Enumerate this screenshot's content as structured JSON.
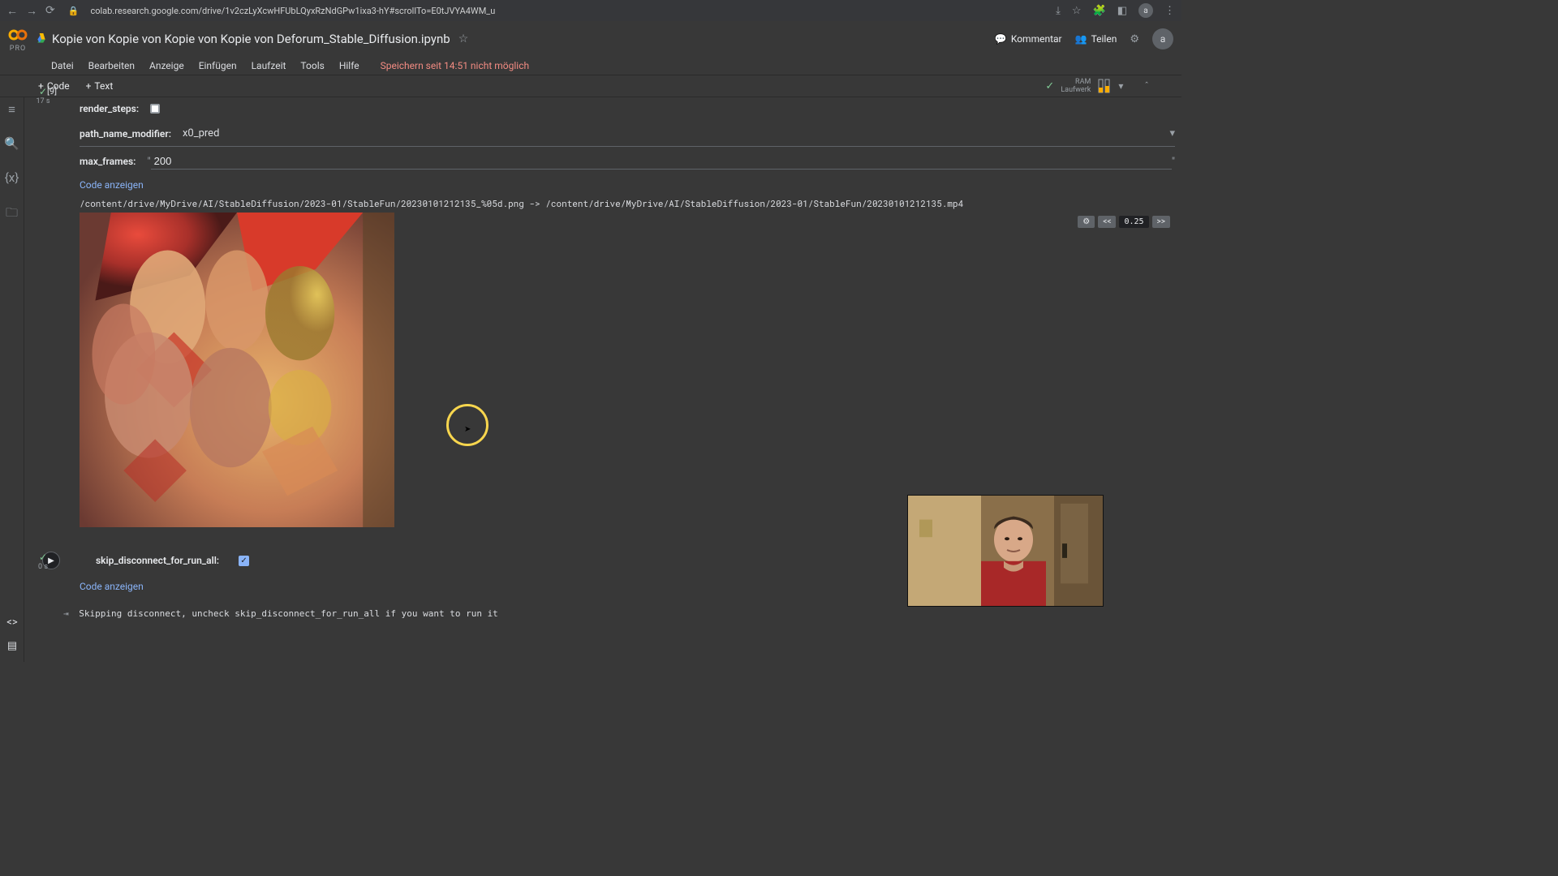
{
  "browser": {
    "url": "colab.research.google.com/drive/1v2czLyXcwHFUbLQyxRzNdGPw1ixa3-hY#scrollTo=E0tJVYA4WM_u",
    "avatar": "a"
  },
  "header": {
    "pro": "PRO",
    "title": "Kopie von Kopie von Kopie von Kopie von Deforum_Stable_Diffusion.ipynb",
    "comment": "Kommentar",
    "share": "Teilen",
    "avatar": "a"
  },
  "menu": {
    "items": [
      "Datei",
      "Bearbeiten",
      "Anzeige",
      "Einfügen",
      "Laufzeit",
      "Tools",
      "Hilfe"
    ],
    "warning": "Speichern seit 14:51 nicht möglich"
  },
  "toolbar": {
    "code": "Code",
    "text": "Text",
    "ram": "RAM",
    "disk": "Laufwerk"
  },
  "cell1": {
    "index": "[9]",
    "time": "17 s",
    "render_steps_label": "render_steps:",
    "path_name_modifier_label": "path_name_modifier:",
    "path_name_modifier_value": "x0_pred",
    "max_frames_label": "max_frames:",
    "max_frames_value": "200",
    "show_code": "Code anzeigen",
    "output_path": "/content/drive/MyDrive/AI/StableDiffusion/2023-01/StableFun/20230101212135_%05d.png -> /content/drive/MyDrive/AI/StableDiffusion/2023-01/StableFun/20230101212135.mp4",
    "speed": "0.25",
    "prev": "<<",
    "next": ">>"
  },
  "cell2": {
    "time": "0 s",
    "skip_label": "skip_disconnect_for_run_all:",
    "show_code": "Code anzeigen",
    "console": "Skipping disconnect, uncheck skip_disconnect_for_run_all if you want to run it"
  },
  "colors": {
    "accent": "#8ab4f8"
  }
}
